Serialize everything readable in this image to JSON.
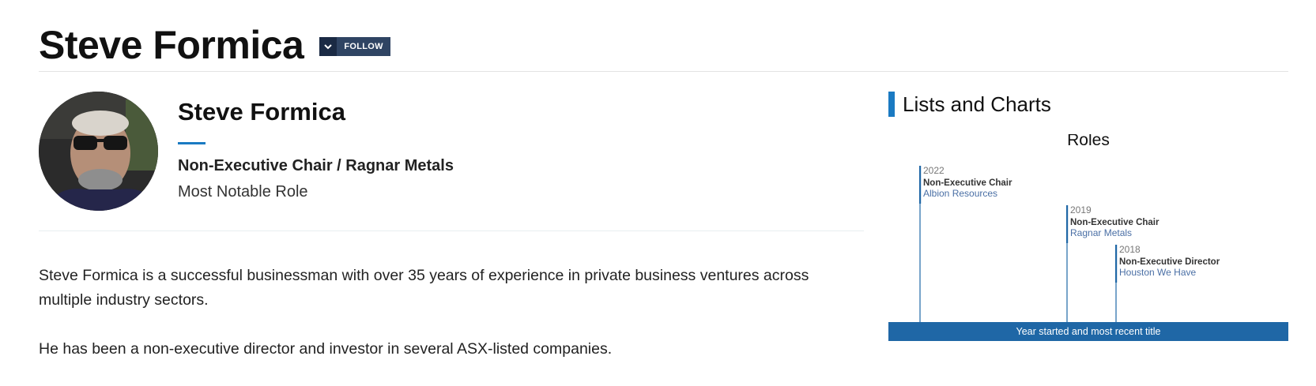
{
  "header": {
    "title": "Steve Formica",
    "follow_label": "FOLLOW"
  },
  "profile": {
    "name": "Steve Formica",
    "role": "Non-Executive Chair / Ragnar Metals",
    "role_caption": "Most Notable Role"
  },
  "bio": [
    "Steve Formica is a successful businessman with over 35 years of experience in private business ventures across multiple industry sectors.",
    "He has been a non-executive director and investor in several ASX-listed companies."
  ],
  "sidebar": {
    "heading": "Lists and Charts"
  },
  "colors": {
    "accent": "#1a7ac2",
    "footer_band": "#1f67a6",
    "follow_bg": "#2f4463",
    "company_link": "#4a6fa5"
  },
  "chart_data": {
    "type": "timeline",
    "title": "Roles",
    "footer": "Year started and most recent title",
    "entries": [
      {
        "year": 2022,
        "title": "Non-Executive Chair",
        "company": "Albion Resources"
      },
      {
        "year": 2019,
        "title": "Non-Executive Chair",
        "company": "Ragnar Metals"
      },
      {
        "year": 2018,
        "title": "Non-Executive Director",
        "company": "Houston We Have"
      }
    ]
  }
}
